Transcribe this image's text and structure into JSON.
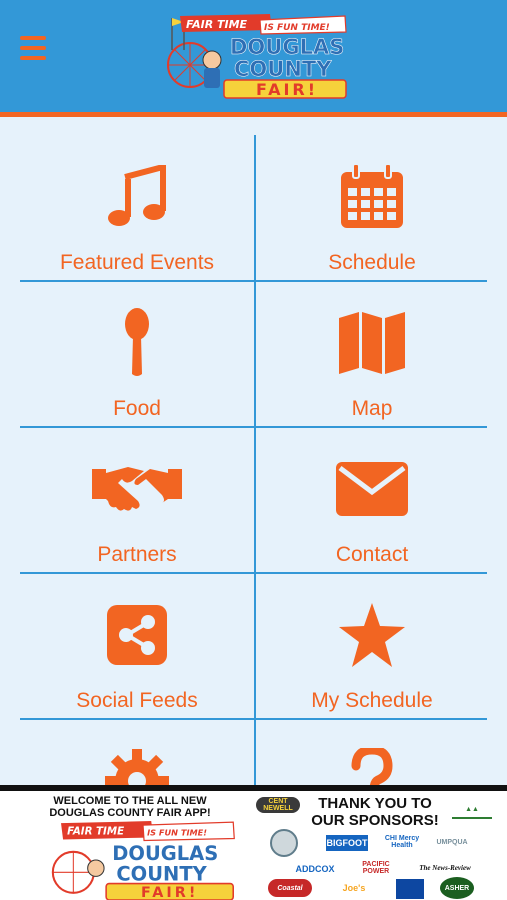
{
  "header": {
    "logo_top": "FAIR TIME",
    "logo_mid": "IS FUN TIME!",
    "logo_line1": "DOUGLAS",
    "logo_line2": "COUNTY",
    "logo_line3": "FAIR!"
  },
  "tiles": [
    {
      "label": "Featured Events",
      "icon": "music-note-icon"
    },
    {
      "label": "Schedule",
      "icon": "calendar-icon"
    },
    {
      "label": "Food",
      "icon": "spoon-icon"
    },
    {
      "label": "Map",
      "icon": "map-icon"
    },
    {
      "label": "Partners",
      "icon": "handshake-icon"
    },
    {
      "label": "Contact",
      "icon": "envelope-icon"
    },
    {
      "label": "Social Feeds",
      "icon": "share-icon"
    },
    {
      "label": "My Schedule",
      "icon": "star-icon"
    },
    {
      "label": "",
      "icon": "gear-icon"
    },
    {
      "label": "",
      "icon": "question-icon"
    }
  ],
  "banner": {
    "welcome_line1": "WELCOME TO THE ALL NEW",
    "welcome_line2": "DOUGLAS COUNTY FAIR APP!",
    "thanks_line1": "THANK YOU TO",
    "thanks_line2": "OUR SPONSORS!",
    "sponsors": [
      "CENT NEWELL",
      "BIGFOOT",
      "CHI Mercy Health",
      "UMPQUA",
      "ADDCOX",
      "PACIFIC POWER",
      "The News-Review",
      "Coastal",
      "Joe's",
      "ASHER"
    ]
  },
  "colors": {
    "accent": "#f26522",
    "header_bg": "#3398d7",
    "page_bg": "#e6f2fb"
  }
}
